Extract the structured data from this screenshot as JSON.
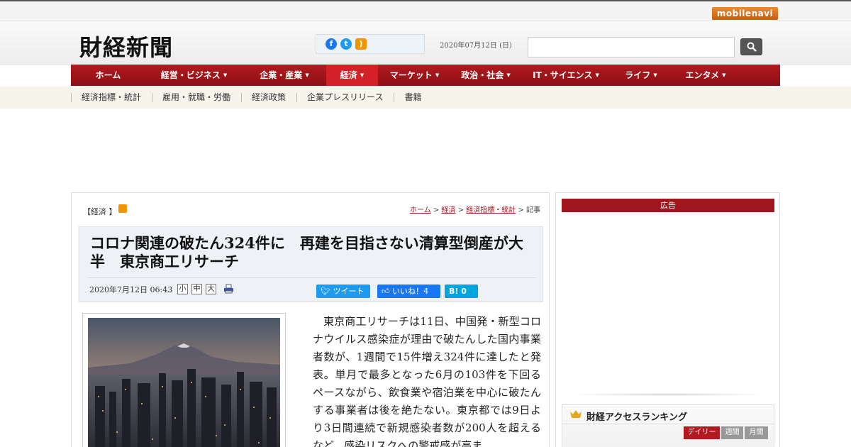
{
  "top": {
    "badge": "mobilenavi"
  },
  "header": {
    "logo": "財経新聞",
    "date": "2020年07月12日 (日)",
    "search": {
      "placeholder": ""
    }
  },
  "nav": [
    {
      "label": "ホーム",
      "caret": false,
      "active": false,
      "width": 105
    },
    {
      "label": "経営・ビジネス",
      "caret": true,
      "active": false,
      "width": 137
    },
    {
      "label": "企業・産業",
      "caret": true,
      "active": false,
      "width": 118
    },
    {
      "label": "経済",
      "caret": true,
      "active": true,
      "width": 73
    },
    {
      "label": "マーケット",
      "caret": true,
      "active": false,
      "width": 103
    },
    {
      "label": "政治・社会",
      "caret": true,
      "active": false,
      "width": 98
    },
    {
      "label": "IT・サイエンス",
      "caret": true,
      "active": false,
      "width": 128
    },
    {
      "label": "ライフ",
      "caret": true,
      "active": false,
      "width": 84
    },
    {
      "label": "エンタメ",
      "caret": true,
      "active": false,
      "width": 98
    }
  ],
  "subnav": [
    "経済指標・統計",
    "雇用・就職・労働",
    "経済政策",
    "企業プレスリリース",
    "書籍"
  ],
  "article": {
    "category": "【経済 】",
    "breadcrumb": {
      "home": "ホーム",
      "sep": " > ",
      "section": "経済",
      "sub": "経済指標・統計",
      "current": "記事"
    },
    "headline": "コロナ関連の破たん324件に　再建を目指さない清算型倒産が大半　東京商工リサーチ",
    "pubdate": "2020年7月12日 06:43",
    "font_sizes": [
      "小",
      "中",
      "大"
    ],
    "share": {
      "tweet": "ツイート",
      "like": "いいね！4",
      "hatena": "B! 0"
    },
    "body": "東京商工リサーチは11日、中国発・新型コロナウイルス感染症が理由で破たんした国内事業者数が、1週間で15件増え324件に達したと発表。単月で最多となった6月の103件を下回るペースながら、飲食業や宿泊業を中心に破たんする事業者は後を絶たない。東京都では9日より3日間連続で新規感染者数が200人を超えるなど、感染リスクへの警戒感が高ま"
  },
  "sidebar": {
    "ad_label": "広告",
    "ranking": {
      "title": "財経アクセスランキング",
      "tabs": [
        "デイリー",
        "週間",
        "月間"
      ]
    }
  },
  "colors": {
    "brand_red": "#a0161c",
    "nav_active": "#d42128"
  }
}
